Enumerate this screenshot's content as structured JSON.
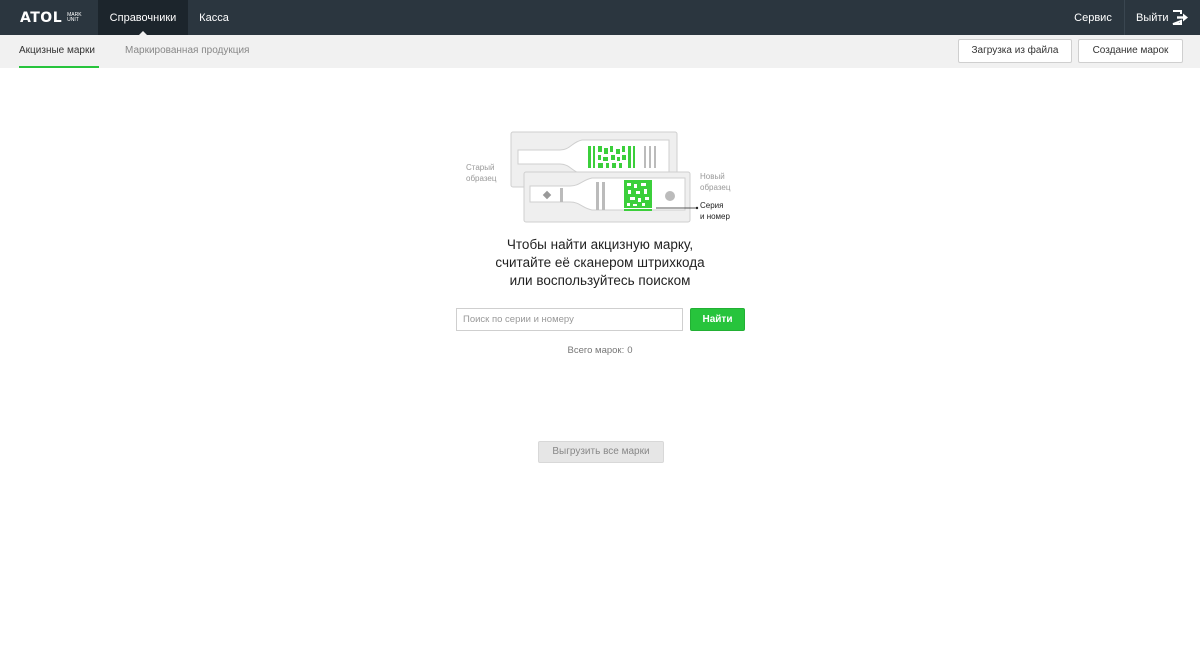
{
  "app": {
    "logo_text": "ATOL",
    "logo_sub_line1": "MARK",
    "logo_sub_line2": "UNIT"
  },
  "topnav": {
    "items": [
      {
        "label": "Справочники",
        "active": true
      },
      {
        "label": "Касса",
        "active": false
      }
    ],
    "service_label": "Сервис",
    "logout_label": "Выйти"
  },
  "subnav": {
    "tabs": [
      {
        "label": "Акцизные марки",
        "active": true
      },
      {
        "label": "Маркированная продукция",
        "active": false
      }
    ],
    "upload_button": "Загрузка из файла",
    "create_button": "Создание марок"
  },
  "illustration": {
    "old_sample_line1": "Старый",
    "old_sample_line2": "образец",
    "new_sample_line1": "Новый",
    "new_sample_line2": "образец",
    "series_line1": "Серия",
    "series_line2": "и номер"
  },
  "main": {
    "message_line1": "Чтобы найти акцизную марку,",
    "message_line2": "считайте её сканером штрихкода",
    "message_line3": "или воспользуйтесь поиском",
    "search_placeholder": "Поиск по серии и номеру",
    "search_value": "",
    "find_button": "Найти",
    "total_label": "Всего марок:",
    "total_count": "0",
    "export_button": "Выгрузить все марки"
  },
  "colors": {
    "topbar": "#2b363f",
    "accent_green": "#27c43c",
    "subbar": "#f1f1f1"
  }
}
